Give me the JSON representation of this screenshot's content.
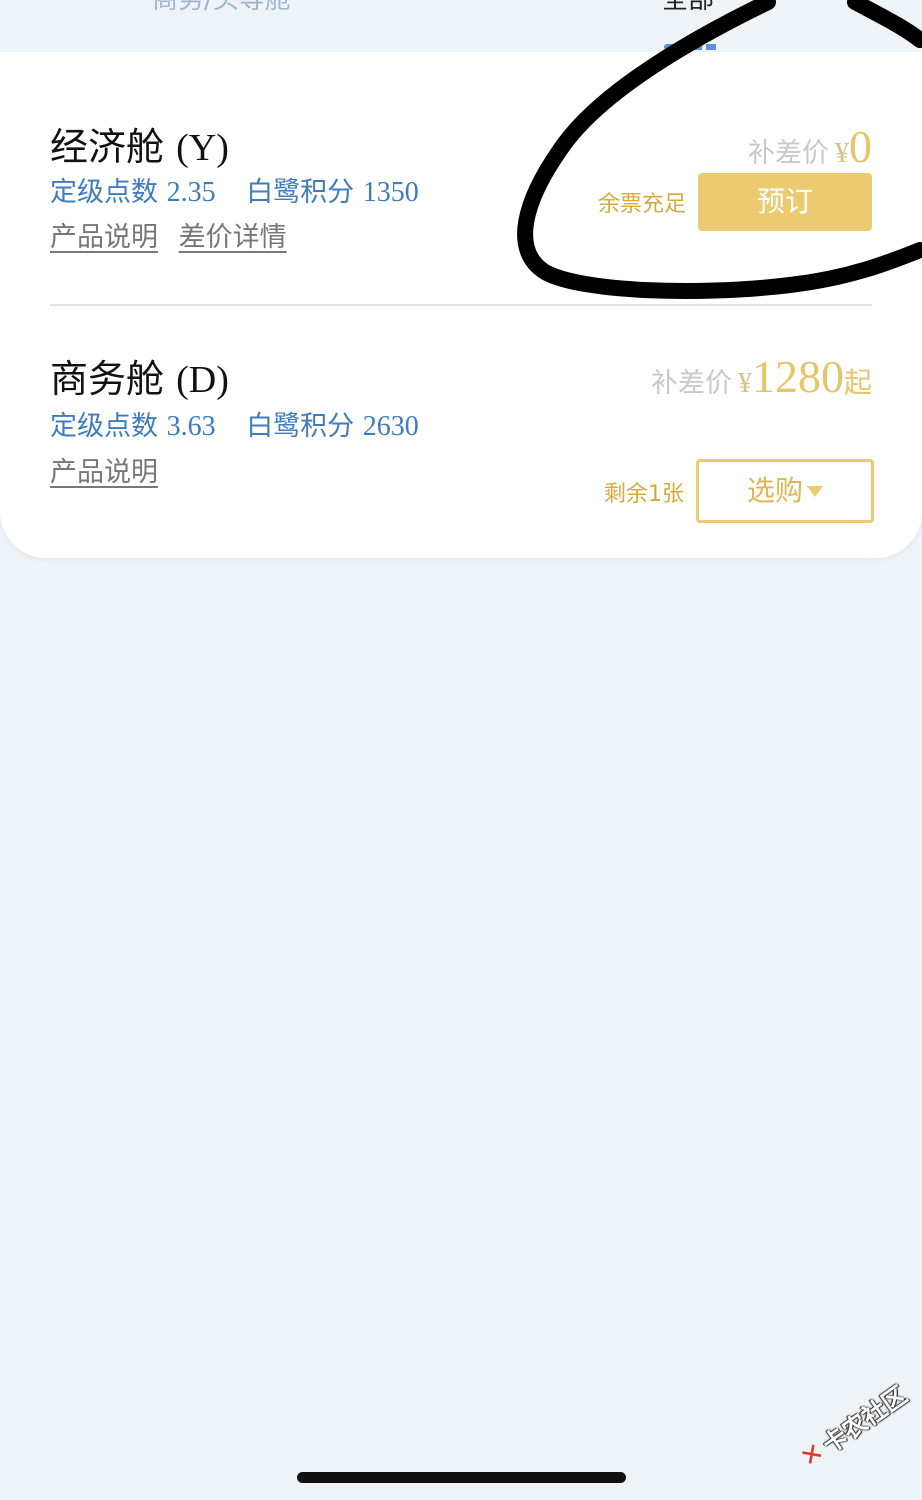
{
  "tabs": {
    "left_label": "商务/头等舱",
    "right_label": "全部"
  },
  "cabins": [
    {
      "name": "经济舱",
      "code": "(Y)",
      "grade_points_label": "定级点数",
      "grade_points_value": "2.35",
      "egret_points_label": "白鹭积分",
      "egret_points_value": "1350",
      "link_product": "产品说明",
      "link_diff": "差价详情",
      "price_prefix": "补差价",
      "currency": "¥",
      "price_amount": "0",
      "ticket_status": "余票充足",
      "action_label": "预订"
    },
    {
      "name": "商务舱",
      "code": "(D)",
      "grade_points_label": "定级点数",
      "grade_points_value": "3.63",
      "egret_points_label": "白鹭积分",
      "egret_points_value": "2630",
      "link_product": "产品说明",
      "price_prefix": "补差价",
      "currency": "¥",
      "price_amount": "1280",
      "price_suffix": "起",
      "ticket_status": "剩余1张",
      "action_label": "选购"
    }
  ],
  "colors": {
    "page_background": "#eef3f8",
    "accent_gold": "#ecca72",
    "stat_blue": "#3f7cbf",
    "annotation_ink": "#000000"
  },
  "watermark": {
    "text": "卡农社区"
  }
}
